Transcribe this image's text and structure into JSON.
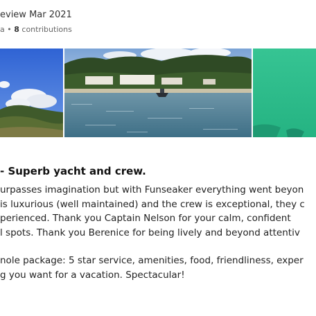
{
  "review": {
    "date_text": "eview Mar 2021",
    "location_fragment": "a",
    "contributions_count": "8",
    "contributions_label": "contributions",
    "title": "- Superb yacht and crew.",
    "body_lines": [
      "urpasses imagination but with Funseaker everything went beyon",
      "is luxurious (well maintained) and the crew is exceptional, they c",
      "perienced. Thank you Captain Nelson for your calm, confident",
      "l spots. Thank you Berenice for being lively and beyond attentiv",
      "nole package: 5 star service, amenities, food, friendliness, exper",
      "g you want for a vacation. Spectacular!"
    ]
  },
  "photos": [
    {
      "subject": "hillside-sky-photo"
    },
    {
      "subject": "bay-with-resort-and-boat-photo"
    },
    {
      "subject": "turquoise-water-photo"
    }
  ],
  "colors": {
    "sky": "#3a6fd8",
    "sea": "#4d7f96",
    "turquoise": "#2fbf8f",
    "hills": "#3d5a2a"
  }
}
